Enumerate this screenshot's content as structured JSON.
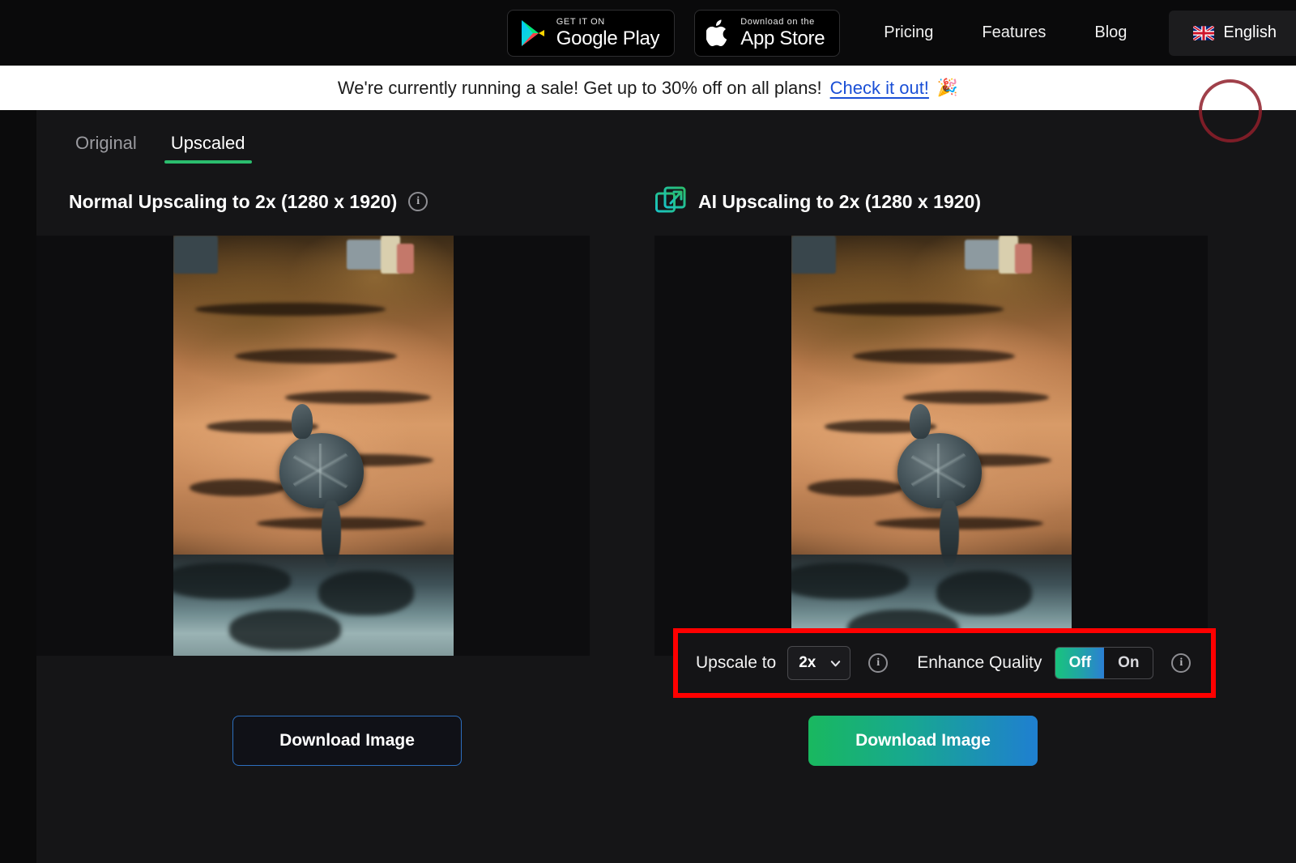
{
  "topnav": {
    "google_play": {
      "small": "GET IT ON",
      "big": "Google Play"
    },
    "app_store": {
      "small": "Download on the",
      "big": "App Store"
    },
    "links": [
      {
        "label": "Pricing"
      },
      {
        "label": "Features"
      },
      {
        "label": "Blog"
      }
    ],
    "language": {
      "label": "English",
      "icon": "uk-flag-icon"
    }
  },
  "banner": {
    "text": "We're currently running a sale! Get up to 30% off on all plans!",
    "link": "Check it out!",
    "emoji": "🎉"
  },
  "tabs": [
    {
      "label": "Original",
      "active": false
    },
    {
      "label": "Upscaled",
      "active": true
    }
  ],
  "left_panel": {
    "title": "Normal Upscaling to 2x (1280 x 1920)",
    "info_icon": "info-icon",
    "download_label": "Download Image"
  },
  "right_panel": {
    "icon": "ai-upscale-icon",
    "title": "AI Upscaling to 2x (1280 x 1920)",
    "download_label": "Download Image",
    "controls": {
      "upscale_label": "Upscale to",
      "upscale_value": "2x",
      "upscale_info_icon": "info-icon",
      "enhance_label": "Enhance Quality",
      "enhance_options": [
        "Off",
        "On"
      ],
      "enhance_selected": "Off",
      "enhance_info_icon": "info-icon"
    }
  },
  "colors": {
    "accent_green": "#2bbd6e",
    "highlight_red": "#ff0000",
    "link_blue": "#1a4fd6",
    "gradient_start": "#19b85f",
    "gradient_end": "#1f7fd1"
  }
}
